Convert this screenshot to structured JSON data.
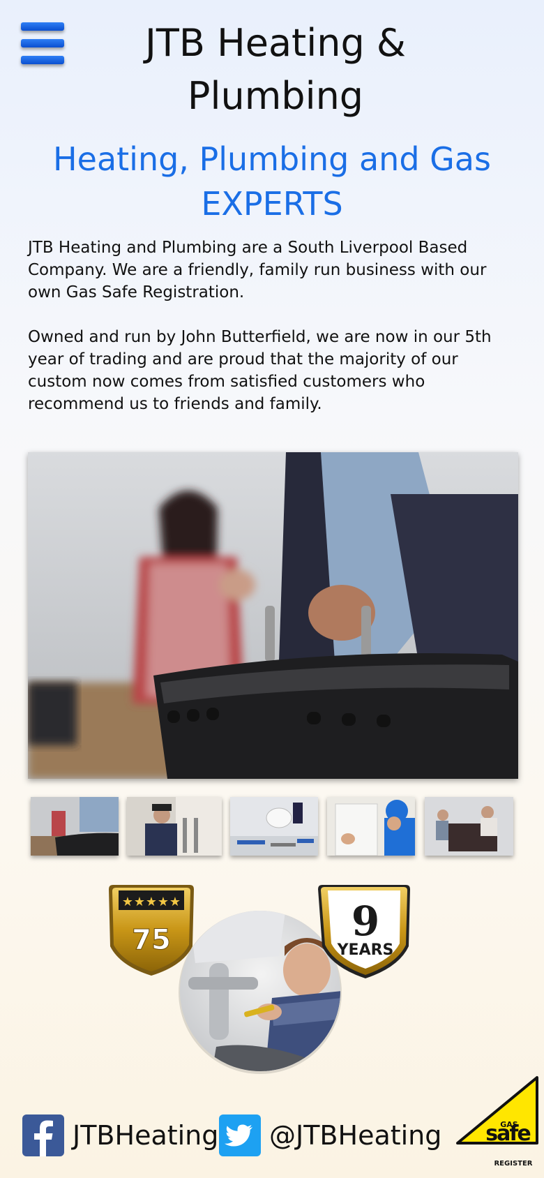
{
  "header": {
    "title": "JTB Heating & Plumbing",
    "menu_icon": "hamburger-menu-icon"
  },
  "hero_text": {
    "tagline": "Heating, Plumbing and Gas EXPERTS",
    "paragraphs": [
      "JTB Heating and Plumbing are a South Liverpool Based Company. We are a friendly, family run business with our own Gas Safe Registration.",
      "Owned and run by John Butterfield, we are now in our 5th year of trading and are proud that the majority of our custom now comes from satisfied customers who recommend us to friends and family."
    ]
  },
  "gallery": {
    "thumbnail_count": 5
  },
  "badges": {
    "rating_number": "75",
    "stars": 5,
    "years_number": "9",
    "years_label": "YEARS"
  },
  "social": {
    "facebook_handle": "JTBHeating",
    "twitter_handle": "@JTBHeating"
  },
  "gas_safe_logo": {
    "top": "GAS",
    "main": "safe",
    "bottom": "REGISTER"
  },
  "colors": {
    "accent_blue": "#1a6ee6",
    "facebook_blue": "#3b5998",
    "twitter_blue": "#1da1f2",
    "gold": "#d4a21e",
    "gas_safe_yellow": "#ffe600"
  }
}
